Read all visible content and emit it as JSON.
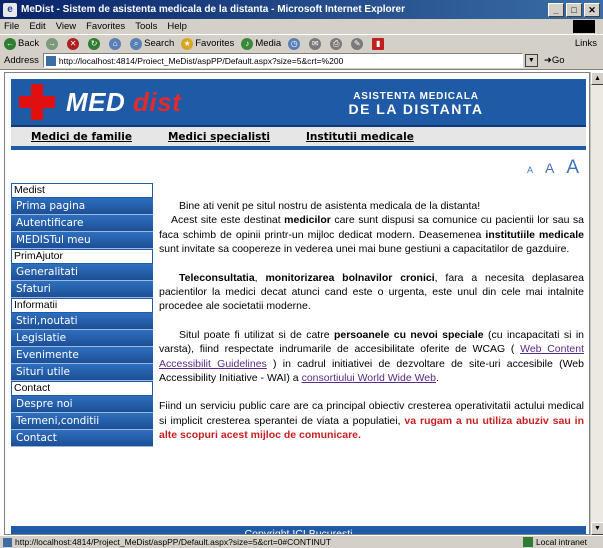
{
  "window": {
    "title": "MeDist - Sistem de asistenta medicala de la distanta - Microsoft Internet Explorer",
    "menu": [
      "File",
      "Edit",
      "View",
      "Favorites",
      "Tools",
      "Help"
    ],
    "toolbar": {
      "back": "Back",
      "search": "Search",
      "favorites": "Favorites",
      "media": "Media",
      "links": "Links"
    },
    "address_label": "Address",
    "address_value": "http://localhost:4814/Proiect_MeDist/aspPP/Default.aspx?size=5&crt=%200",
    "go_label": "Go",
    "status_text": "http://localhost:4814/Project_MeDist/aspPP/Default.aspx?size=5&crt=0#CONTINUT",
    "zone_label": "Local intranet"
  },
  "site": {
    "logo_part1": "MED",
    "logo_part2": "dist",
    "tagline_line1": "ASISTENTA MEDICALA",
    "tagline_line2": "DE LA DISTANTA",
    "topnav": [
      "Medici de familie",
      "Medici specialisti",
      "Institutii medicale"
    ],
    "font_sizes": [
      "A",
      "A",
      "A"
    ]
  },
  "sidebar": {
    "sections": [
      {
        "title": "Medist",
        "items": [
          "Prima pagina",
          "Autentificare",
          "MEDISTul meu"
        ]
      },
      {
        "title": "PrimAjutor",
        "items": [
          "Generalitati",
          "Sfaturi"
        ]
      },
      {
        "title": "Informatii",
        "items": [
          "Stiri,noutati",
          "Legislatie",
          "Evenimente",
          "Situri utile"
        ]
      },
      {
        "title": "Contact",
        "items": [
          "Despre noi",
          "Termeni,conditii",
          "Contact"
        ]
      }
    ]
  },
  "content": {
    "p1": "Bine ati venit pe situl nostru de asistenta medicala de la distanta!",
    "p2_a": "Acest site este destinat ",
    "p2_b1": "medicilor",
    "p2_c": " care sunt dispusi sa comunice cu pacientii lor sau sa faca schimb de opinii printr-un mijloc dedicat modern. Deasemenea ",
    "p2_b2": "institutiile medicale",
    "p2_d": " sunt invitate sa coopereze in vederea unei mai bune gestiuni a capacitatilor de gazduire.",
    "p3_b1": "Teleconsultatia",
    "p3_a": ", ",
    "p3_b2": "monitorizarea bolnavilor cronici",
    "p3_c": ", fara a necesita deplasarea pacientilor la medici decat atunci cand este o urgenta, este unul din cele mai intalnite procedee ale societatii moderne.",
    "p4_a": "Situl poate fi utilizat si de catre ",
    "p4_b": "persoanele cu nevoi speciale",
    "p4_c": " (cu incapacitati si in varsta), fiind respectate indrumarile de accesibilitate oferite de WCAG ( ",
    "p4_link1": "Web Content Accessibilit Guidelines",
    "p4_d": " ) in cadrul initiativei de dezvoltare de site-uri accesibile (Web Accessibility Initiative - WAI) a ",
    "p4_link2": "consortiului World Wide Web",
    "p4_e": ".",
    "p5_a": "Fiind un serviciu public care are ca principal obiectiv cresterea operativitatii actului medical si implicit cresterea sperantei de viata a populatiei, ",
    "p5_red": "va rugam a nu utiliza abuziv sau in alte scopuri acest mijloc de comunicare",
    "p5_end": "."
  },
  "footer": "Copyright ICI Bucuresti"
}
